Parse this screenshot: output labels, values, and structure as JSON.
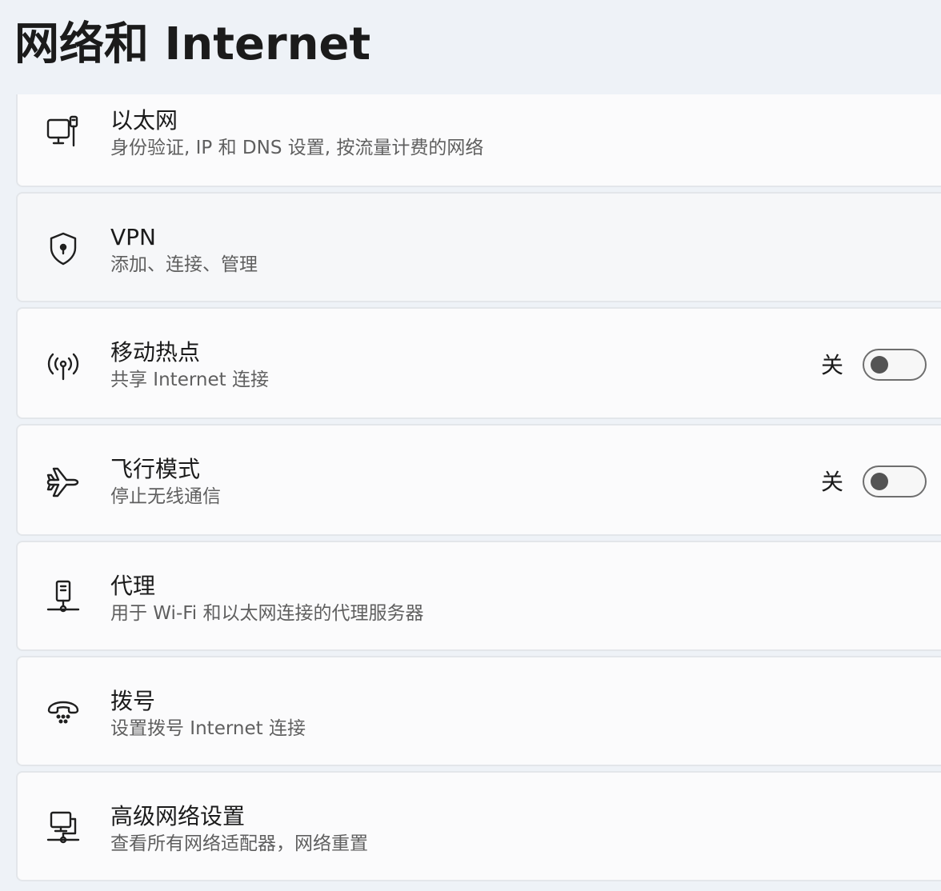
{
  "header": {
    "title": "网络和 Internet"
  },
  "items": [
    {
      "title": "以太网",
      "subtitle": "身份验证, IP 和 DNS 设置, 按流量计费的网络",
      "icon": "ethernet-icon"
    },
    {
      "title": "VPN",
      "subtitle": "添加、连接、管理",
      "icon": "vpn-shield-icon"
    },
    {
      "title": "移动热点",
      "subtitle": "共享 Internet 连接",
      "icon": "hotspot-icon",
      "toggle_label": "关",
      "toggle_on": false
    },
    {
      "title": "飞行模式",
      "subtitle": "停止无线通信",
      "icon": "airplane-icon",
      "toggle_label": "关",
      "toggle_on": false
    },
    {
      "title": "代理",
      "subtitle": "用于 Wi-Fi 和以太网连接的代理服务器",
      "icon": "proxy-icon"
    },
    {
      "title": "拨号",
      "subtitle": "设置拨号 Internet 连接",
      "icon": "dialup-icon"
    },
    {
      "title": "高级网络设置",
      "subtitle": "查看所有网络适配器，网络重置",
      "icon": "advanced-network-icon"
    }
  ]
}
